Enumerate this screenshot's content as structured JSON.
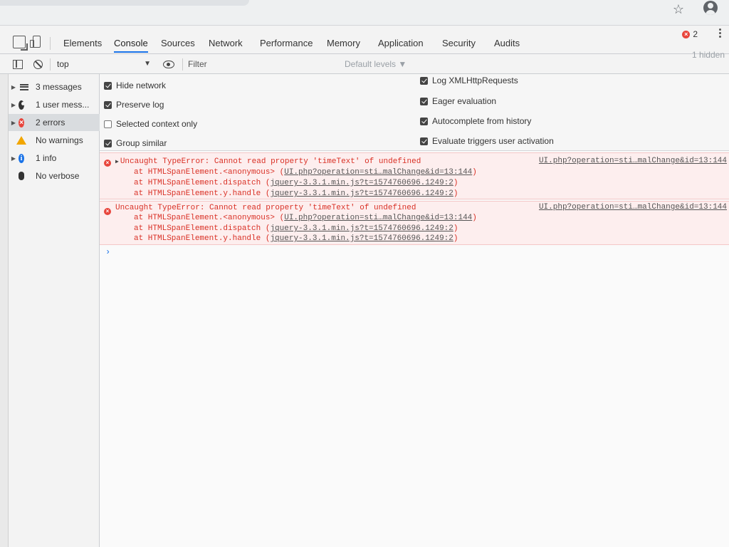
{
  "browser": {
    "star_glyph": "☆"
  },
  "devtools": {
    "tabs": [
      "Elements",
      "Console",
      "Sources",
      "Network",
      "Performance",
      "Memory",
      "Application",
      "Security",
      "Audits"
    ],
    "active_tab": "Console",
    "error_count": "2"
  },
  "toolbar": {
    "context": "top",
    "filter_placeholder": "Filter",
    "levels": "Default levels ▼",
    "hidden": "1 hidden"
  },
  "settings": {
    "left": [
      {
        "label": "Hide network",
        "checked": true
      },
      {
        "label": "Preserve log",
        "checked": true
      },
      {
        "label": "Selected context only",
        "checked": false
      },
      {
        "label": "Group similar",
        "checked": true
      }
    ],
    "right": [
      {
        "label": "Log XMLHttpRequests",
        "checked": true
      },
      {
        "label": "Eager evaluation",
        "checked": true
      },
      {
        "label": "Autocomplete from history",
        "checked": true
      },
      {
        "label": "Evaluate triggers user activation",
        "checked": true
      }
    ]
  },
  "sidebar": {
    "items": [
      {
        "label": "3 messages",
        "icon": "list-icon"
      },
      {
        "label": "1 user mess...",
        "icon": "user-icon"
      },
      {
        "label": "2 errors",
        "icon": "error-icon"
      },
      {
        "label": "No warnings",
        "icon": "warning-icon"
      },
      {
        "label": "1 info",
        "icon": "info-icon"
      },
      {
        "label": "No verbose",
        "icon": "bug-icon"
      }
    ]
  },
  "messages": [
    {
      "text": "Uncaught TypeError: Cannot read property 'timeText' of undefined",
      "source": "UI.php?operation=sti…malChange&id=13:144",
      "stack": [
        {
          "prefix": "at HTMLSpanElement.<anonymous> (",
          "link": "UI.php?operation=sti…malChange&id=13:144",
          "suffix": ")"
        },
        {
          "prefix": "at HTMLSpanElement.dispatch (",
          "link": "jquery-3.3.1.min.js?t=1574760696.1249:2",
          "suffix": ")"
        },
        {
          "prefix": "at HTMLSpanElement.y.handle (",
          "link": "jquery-3.3.1.min.js?t=1574760696.1249:2",
          "suffix": ")"
        }
      ]
    },
    {
      "text": "Uncaught TypeError: Cannot read property 'timeText' of undefined",
      "source": "UI.php?operation=sti…malChange&id=13:144",
      "stack": [
        {
          "prefix": "at HTMLSpanElement.<anonymous> (",
          "link": "UI.php?operation=sti…malChange&id=13:144",
          "suffix": ")"
        },
        {
          "prefix": "at HTMLSpanElement.dispatch (",
          "link": "jquery-3.3.1.min.js?t=1574760696.1249:2",
          "suffix": ")"
        },
        {
          "prefix": "at HTMLSpanElement.y.handle (",
          "link": "jquery-3.3.1.min.js?t=1574760696.1249:2",
          "suffix": ")"
        }
      ]
    }
  ],
  "prompt_glyph": "›"
}
